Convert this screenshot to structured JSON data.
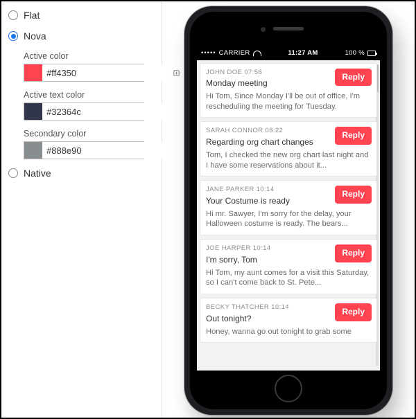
{
  "themes": {
    "flat_label": "Flat",
    "nova_label": "Nova",
    "native_label": "Native",
    "selected": "nova"
  },
  "nova": {
    "active_color_label": "Active color",
    "active_color_value": "#ff4350",
    "active_text_label": "Active text color",
    "active_text_value": "#32364c",
    "secondary_label": "Secondary color",
    "secondary_value": "#888e90"
  },
  "status_bar": {
    "carrier": "CARRIER",
    "time": "11:27 AM",
    "battery": "100 %"
  },
  "reply_label": "Reply",
  "messages": [
    {
      "sender": "JOHN DOE",
      "time": "07:56",
      "subject": "Monday meeting",
      "body": "Hi Tom, Since Monday I'll be out of office, I'm rescheduling the meeting for Tuesday."
    },
    {
      "sender": "SARAH CONNOR",
      "time": "08:22",
      "subject": "Regarding org chart changes",
      "body": "Tom, I checked the new org chart last night and I have some reservations about it..."
    },
    {
      "sender": "JANE PARKER",
      "time": "10:14",
      "subject": "Your Costume is ready",
      "body": "Hi mr. Sawyer, I'm sorry for the delay, your Halloween costume is ready. The bears..."
    },
    {
      "sender": "JOE HARPER",
      "time": "10:14",
      "subject": "I'm sorry, Tom",
      "body": "Hi Tom, my aunt comes for a visit this Saturday, so I can't come back to St. Pete..."
    },
    {
      "sender": "BECKY THATCHER",
      "time": "10:14",
      "subject": "Out tonight?",
      "body": "Honey, wanna go out tonight to grab some"
    }
  ]
}
